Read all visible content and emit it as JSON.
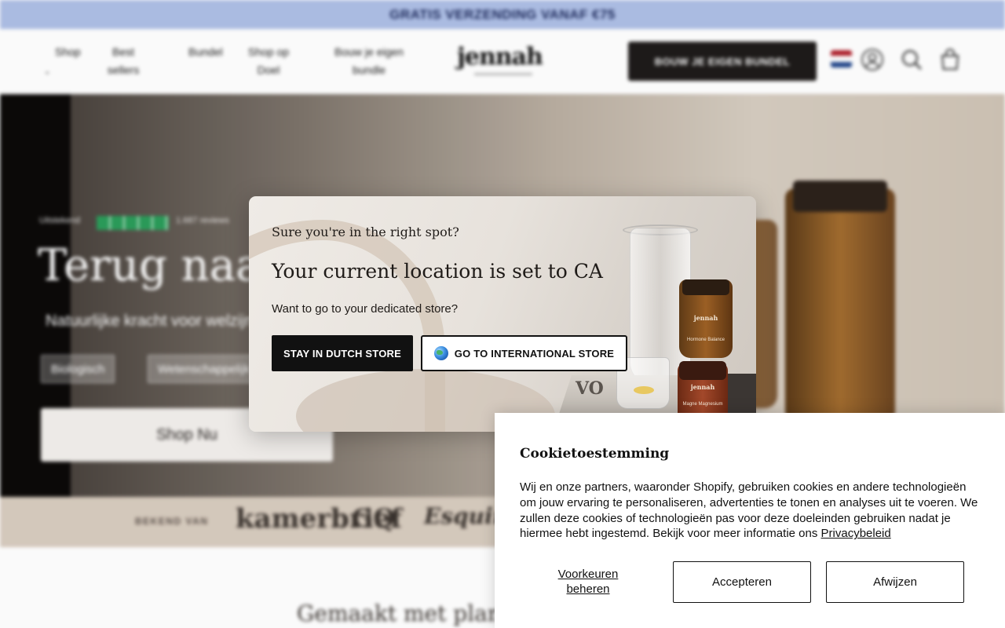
{
  "announcement": "GRATIS VERZENDING VANAF €75",
  "header": {
    "nav": [
      {
        "label": "Shop"
      },
      {
        "label": "Best sellers"
      },
      {
        "label": "Bundel"
      },
      {
        "label": "Shop op Doel"
      },
      {
        "label": "Bouw je eigen bundle"
      }
    ],
    "logo": "jennah",
    "cta": "BOUW JE EIGEN BUNDEL"
  },
  "hero": {
    "trust_text": "Uitstekend",
    "trust_count": "1.687 reviews",
    "title": "Terug naar",
    "subtitle": "Natuurlijke kracht voor welzijn",
    "pills": [
      "Biologisch",
      "Wetenschappelijk"
    ],
    "shop_button": "Shop Nu"
  },
  "known_from": {
    "label": "BEKEND VAN",
    "outlets": [
      "kamerbrief",
      "GQ",
      "Esquire"
    ]
  },
  "below_title": "Gemaakt met planten,",
  "location_modal": {
    "kicker": "Sure you're in the right spot?",
    "title": "Your current location is set to CA",
    "text": "Want to go to your dedicated store?",
    "stay_button": "STAY IN DUTCH STORE",
    "intl_button": "GO TO INTERNATIONAL STORE",
    "product_brand": "jennah",
    "product_1": "Hormone Balance",
    "product_2": "Magne Magnesium",
    "book_text": "VO"
  },
  "cookie": {
    "title": "Cookietoestemming",
    "text": "Wij en onze partners, waaronder Shopify, gebruiken cookies en andere technologieën om jouw ervaring te personaliseren, advertenties te tonen en analyses uit te voeren. We zullen deze cookies of technologieën pas voor deze doeleinden gebruiken nadat je hiermee hebt ingestemd. Bekijk voor meer informatie ons",
    "privacy_link": "Privacybeleid",
    "preferences": "Voorkeuren beheren",
    "accept": "Accepteren",
    "decline": "Afwijzen"
  },
  "colors": {
    "announcement_bg": "#aebfe6",
    "primary_dark": "#1e1b1a",
    "trust_green": "#2b9d5a"
  }
}
